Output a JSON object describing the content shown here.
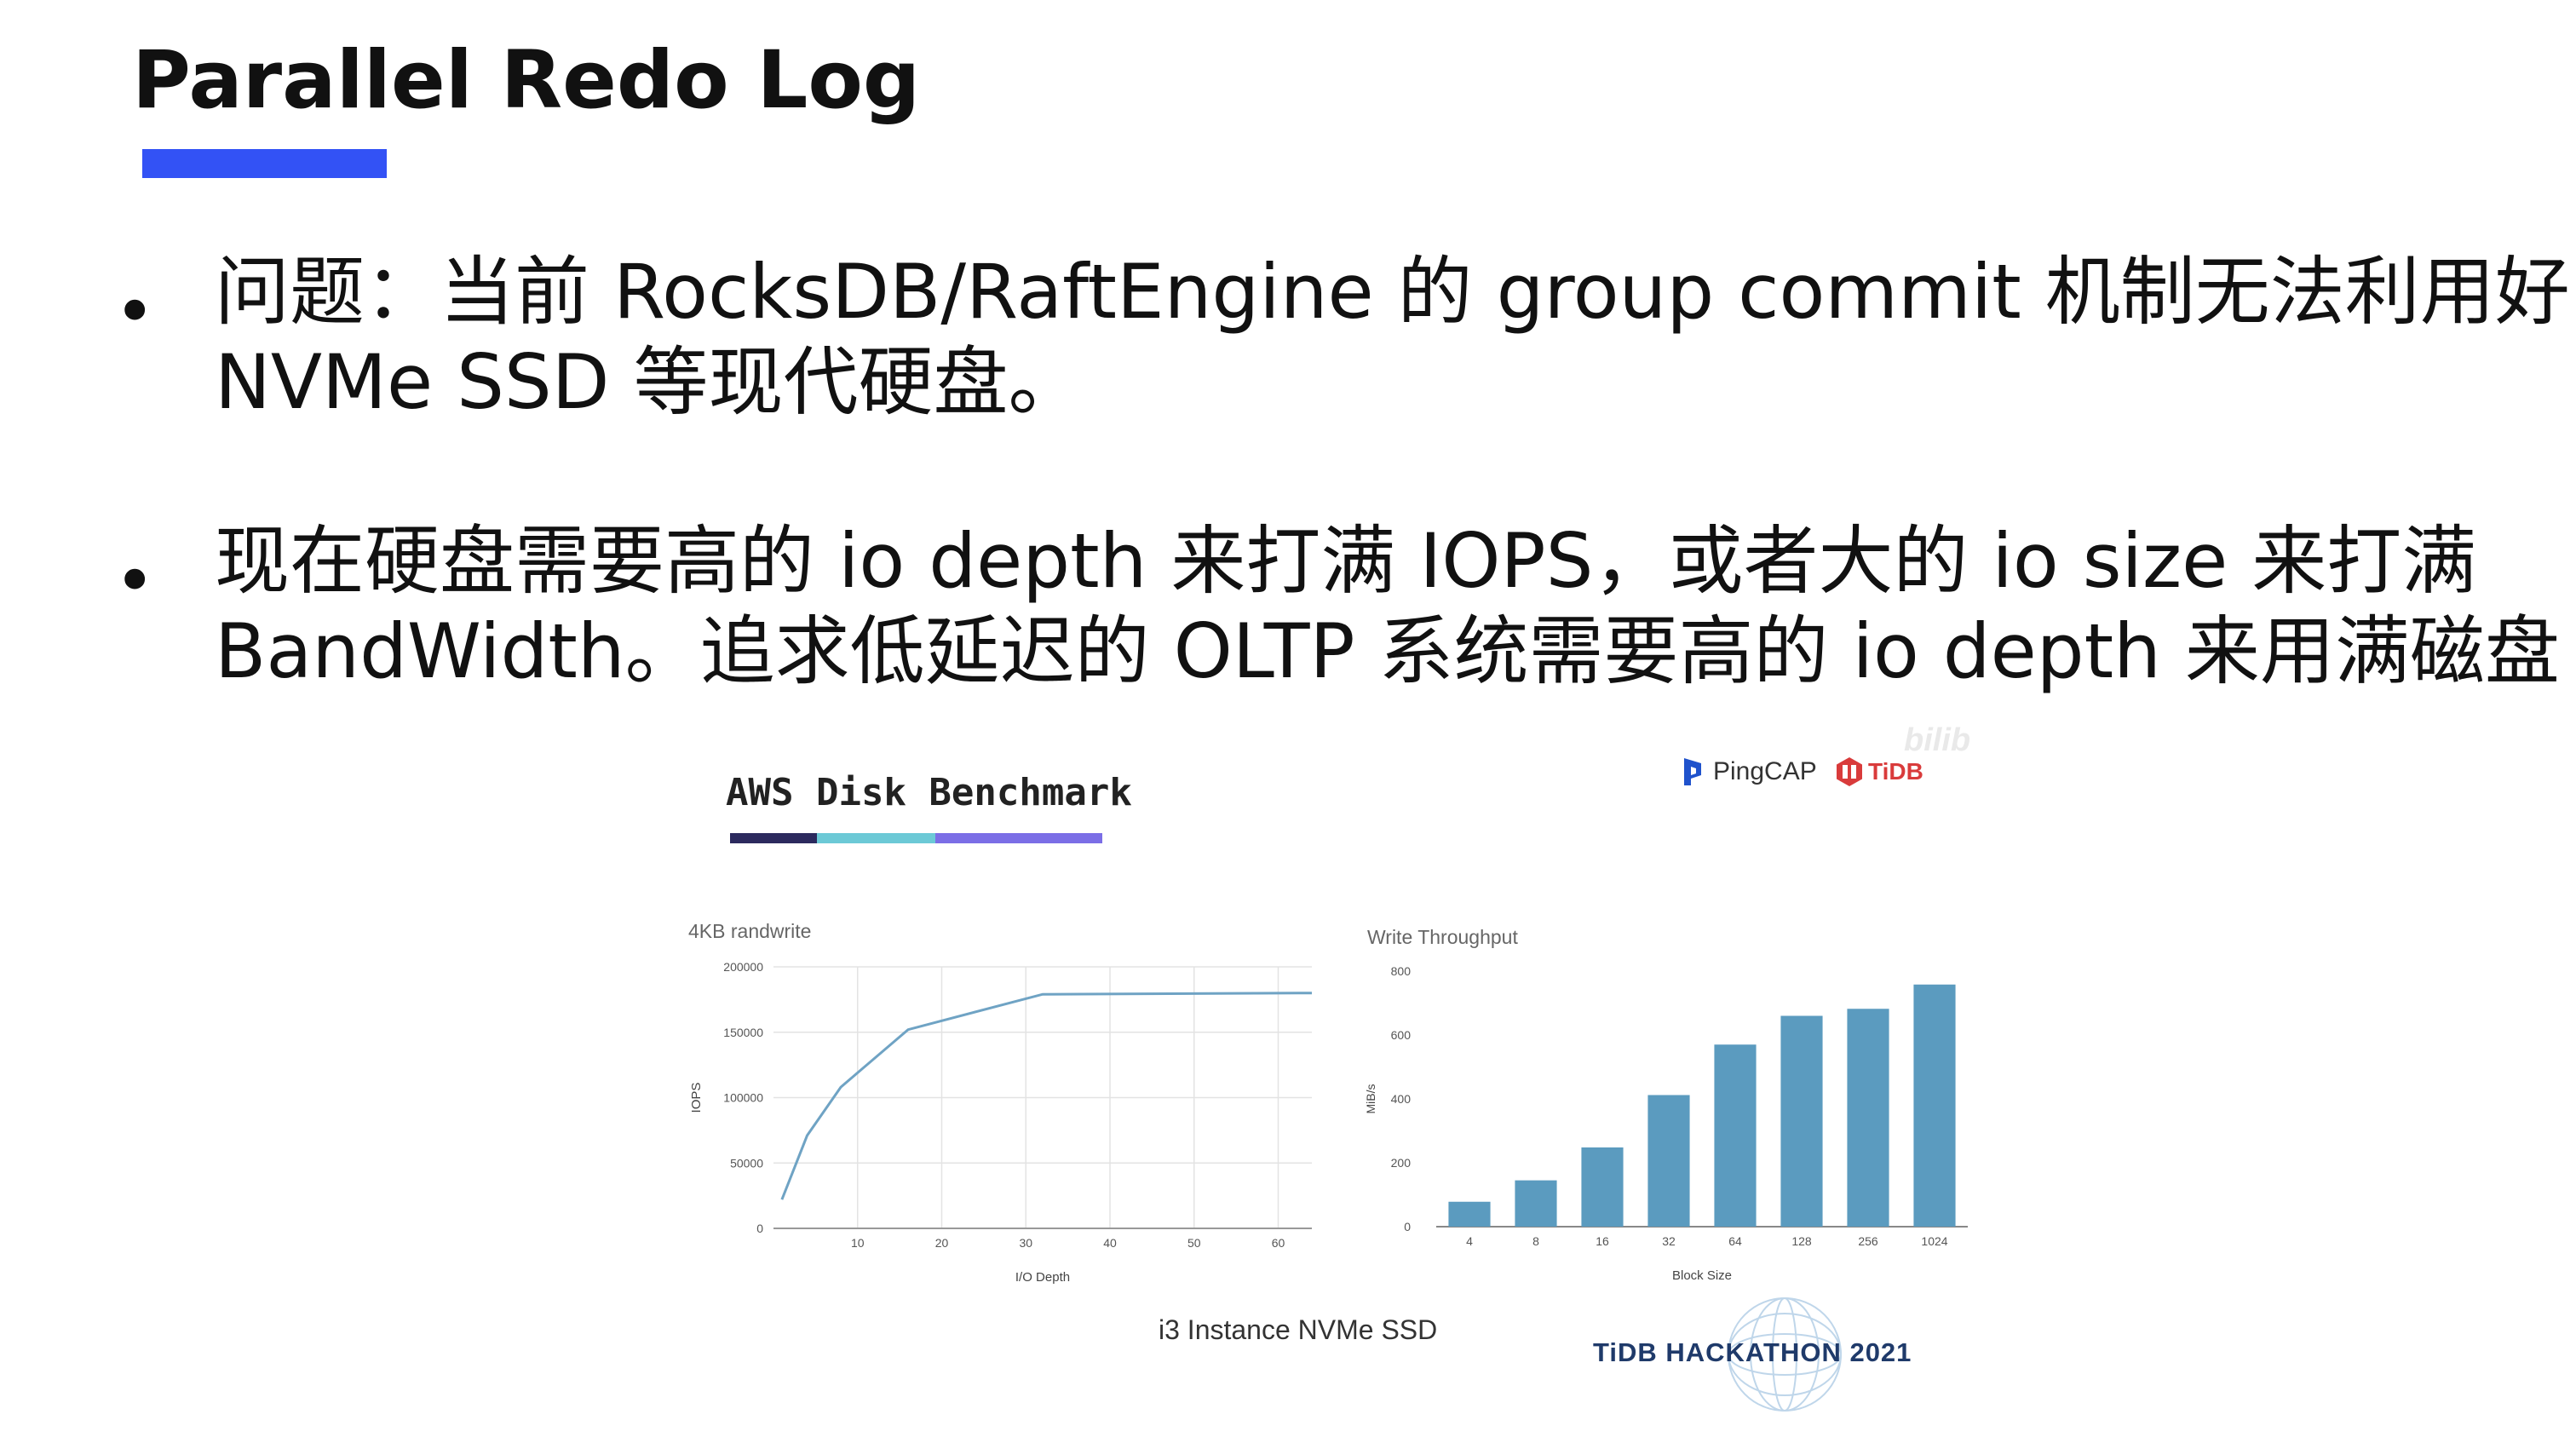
{
  "title": "Parallel Redo Log",
  "accent": "#3352f5",
  "bullets": [
    {
      "line1": "问题：当前 RocksDB/RaftEngine 的 group commit 机制无法利用好",
      "line2": "NVMe SSD 等现代硬盘。"
    },
    {
      "line1": "现在硬盘需要高的 io depth 来打满 IOPS，或者大的 io size 来打满",
      "line2": "BandWidth。追求低延迟的 OLTP 系统需要高的 io depth 来用满磁盘"
    }
  ],
  "benchmark_title": "AWS Disk Benchmark",
  "benchmark_colors": [
    "#2c2a5e",
    "#6cc9d6",
    "#7b6ee6"
  ],
  "logos": {
    "pingcap": "PingCAP",
    "tidb": "TiDB",
    "watermark": "bilib"
  },
  "caption": "i3 Instance NVMe SSD",
  "hackathon": "TiDB HACKATHON 2021",
  "chart_data": [
    {
      "type": "line",
      "title": "4KB randwrite",
      "xlabel": "I/O Depth",
      "ylabel": "IOPS",
      "x": [
        1,
        4,
        8,
        16,
        32,
        64
      ],
      "y": [
        22000,
        71000,
        108000,
        152000,
        179000,
        180000
      ],
      "xlim": [
        0,
        64
      ],
      "ylim": [
        0,
        200000
      ],
      "xticks": [
        10,
        20,
        30,
        40,
        50,
        60
      ],
      "yticks": [
        0,
        50000,
        100000,
        150000,
        200000
      ],
      "grid": true,
      "color": "#6fa3c4"
    },
    {
      "type": "bar",
      "title": "Write Throughput",
      "xlabel": "Block Size",
      "ylabel": "MiB/s",
      "categories": [
        "4",
        "8",
        "16",
        "32",
        "64",
        "128",
        "256",
        "1024"
      ],
      "values": [
        78,
        145,
        248,
        412,
        570,
        660,
        682,
        758
      ],
      "ylim": [
        0,
        800
      ],
      "yticks": [
        0,
        200,
        400,
        600,
        800
      ],
      "grid": false,
      "color": "#5b9bbf"
    }
  ]
}
